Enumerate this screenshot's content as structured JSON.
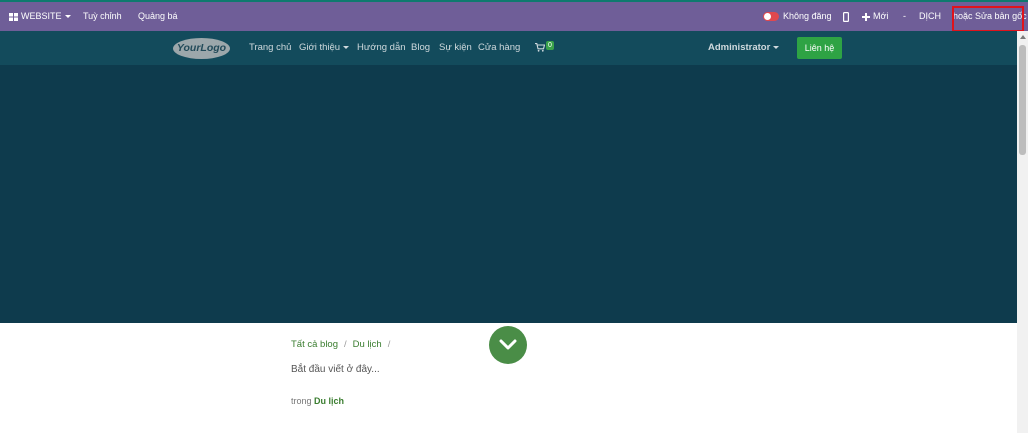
{
  "admin_bar": {
    "website_menu": "WEBSITE",
    "customize": "Tuỳ chỉnh",
    "promote": "Quảng bá",
    "publish_status": "Không đăng",
    "new": "Mới",
    "dash": "-",
    "translate": "DỊCH",
    "edit_original": "hoặc Sửa bản gốc"
  },
  "navbar": {
    "logo": "YourLogo",
    "menu": [
      "Trang chủ",
      "Giới thiệu",
      "Hướng dẫn",
      "Blog",
      "Sự kiện",
      "Cửa hàng"
    ],
    "cart_count": "0",
    "user": "Administrator",
    "contact_button": "Liên hệ"
  },
  "colors": {
    "admin_bar": "#6f5e98",
    "navbar": "#134b5c",
    "hero": "#0e3b4d",
    "accent_green": "#2ea344",
    "highlight_red": "#e0131b"
  },
  "blog": {
    "breadcrumb": [
      "Tất cả blog",
      "Du lịch"
    ],
    "separator": "/",
    "placeholder_text": "Bắt đầu viết ở đây...",
    "category_prefix": "trong",
    "category": "Du lịch"
  }
}
